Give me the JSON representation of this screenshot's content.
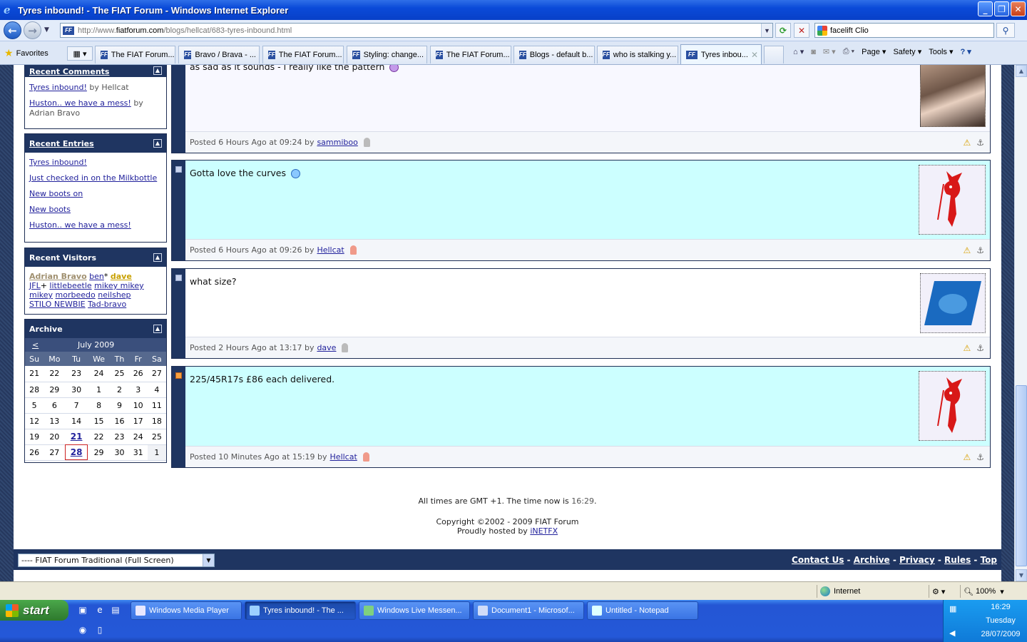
{
  "window": {
    "title": "Tyres inbound! - The FIAT Forum - Windows Internet Explorer"
  },
  "address": {
    "url_prefix": "http://www.",
    "url_domain": "fiatforum.com",
    "url_path": "/blogs/hellcat/683-tyres-inbound.html",
    "search_value": "facelift Clio"
  },
  "favorites_label": "Favorites",
  "tabs": [
    {
      "label": "The FIAT Forum..."
    },
    {
      "label": "Bravo / Brava - ..."
    },
    {
      "label": "The FIAT Forum..."
    },
    {
      "label": "Styling: change..."
    },
    {
      "label": "The FIAT Forum..."
    },
    {
      "label": "Blogs - default b..."
    },
    {
      "label": "who is stalking y..."
    },
    {
      "label": "Tyres inbou..."
    }
  ],
  "commands": {
    "page": "Page",
    "safety": "Safety",
    "tools": "Tools"
  },
  "sidebar": {
    "recent_comments": {
      "title": "Recent Comments",
      "items": [
        {
          "link": "Tyres inbound!",
          "by": "by Hellcat"
        },
        {
          "link": "Huston.. we have a mess!",
          "by": "by Adrian Bravo"
        }
      ]
    },
    "recent_entries": {
      "title": "Recent Entries",
      "items": [
        "Tyres inbound!",
        "Just checked in on the Milkbottle",
        "New boots on",
        "New boots",
        "Huston.. we have a mess!"
      ]
    },
    "recent_visitors": {
      "title": "Recent Visitors",
      "names": [
        "Adrian Bravo",
        "ben",
        "dave",
        "JFL",
        "littlebeetle",
        "mikey mikey",
        "mikey",
        "morbeedo",
        "neilshep",
        "STILO NEWBIE",
        "Tad-bravo"
      ],
      "ben_suffix": "*",
      "jfl_suffix": "+"
    },
    "archive": {
      "title": "Archive",
      "prev": "<",
      "month": "July 2009",
      "weekdays": [
        "Su",
        "Mo",
        "Tu",
        "We",
        "Th",
        "Fr",
        "Sa"
      ],
      "weeks": [
        [
          "21",
          "22",
          "23",
          "24",
          "25",
          "26",
          "27"
        ],
        [
          "28",
          "29",
          "30",
          "1",
          "2",
          "3",
          "4"
        ],
        [
          "5",
          "6",
          "7",
          "8",
          "9",
          "10",
          "11"
        ],
        [
          "12",
          "13",
          "14",
          "15",
          "16",
          "17",
          "18"
        ],
        [
          "19",
          "20",
          "21",
          "22",
          "23",
          "24",
          "25"
        ],
        [
          "26",
          "27",
          "28",
          "29",
          "30",
          "31",
          "1"
        ]
      ]
    }
  },
  "posts": [
    {
      "text": "as sad as it sounds - i really like the pattern",
      "posted": "Posted 6 Hours Ago at 09:24 by",
      "user": "sammiboo"
    },
    {
      "text": "Gotta love the curves",
      "posted": "Posted 6 Hours Ago at 09:26 by",
      "user": "Hellcat"
    },
    {
      "text": "what size?",
      "posted": "Posted 2 Hours Ago at 13:17 by",
      "user": "dave"
    },
    {
      "text": "225/45R17s £86 each delivered.",
      "posted": "Posted 10 Minutes Ago at 15:19 by",
      "user": "Hellcat"
    }
  ],
  "footer": {
    "times_prefix": "All times are GMT +1. The time now is",
    "time_now": "16:29",
    "times_suffix": ".",
    "copyright": "Copyright ©2002 - 2009 FIAT Forum",
    "hosted_prefix": "Proudly hosted by",
    "host": "iNETFX",
    "style_select": "---- FIAT Forum Traditional (Full Screen)",
    "links": [
      "Contact Us",
      "Archive",
      "Privacy",
      "Rules",
      "Top"
    ]
  },
  "status": {
    "zone": "Internet",
    "zoom": "100%"
  },
  "taskbar": {
    "start": "start",
    "tasks": [
      "Windows Media Player",
      "Tyres inbound! - The ...",
      "Windows Live Messen...",
      "Document1 - Microsof...",
      "Untitled - Notepad"
    ],
    "clock_time": "16:29",
    "clock_day": "Tuesday",
    "clock_date": "28/07/2009"
  }
}
